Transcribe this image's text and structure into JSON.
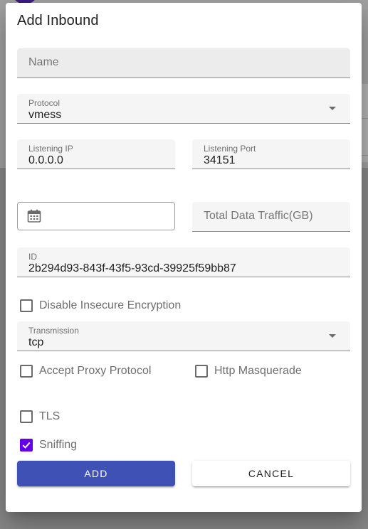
{
  "colors": {
    "primary_button": "#3f51b5",
    "checkbox_checked": "#6200ea",
    "field_fill": "#f5f5f5"
  },
  "dialog": {
    "title": "Add Inbound"
  },
  "fields": {
    "name": {
      "placeholder": "Name",
      "value": ""
    },
    "protocol": {
      "label": "Protocol",
      "value": "vmess"
    },
    "listening_ip": {
      "label": "Listening IP",
      "value": "0.0.0.0"
    },
    "listening_port": {
      "label": "Listening Port",
      "value": "34151"
    },
    "expiry_date": {
      "value": "",
      "icon": "calendar-icon"
    },
    "total_traffic": {
      "placeholder": "Total Data Traffic(GB)",
      "value": ""
    },
    "id": {
      "label": "ID",
      "value": "2b294d93-843f-43f5-93cd-39925f59bb87"
    },
    "transmission": {
      "label": "Transmission",
      "value": "tcp"
    }
  },
  "checkboxes": {
    "disable_insecure": {
      "label": "Disable Insecure Encryption",
      "checked": false
    },
    "accept_proxy": {
      "label": "Accept Proxy Protocol",
      "checked": false
    },
    "http_masquerade": {
      "label": "Http Masquerade",
      "checked": false
    },
    "tls": {
      "label": "TLS",
      "checked": false
    },
    "sniffing": {
      "label": "Sniffing",
      "checked": true
    }
  },
  "buttons": {
    "add": "ADD",
    "cancel": "CANCEL"
  }
}
